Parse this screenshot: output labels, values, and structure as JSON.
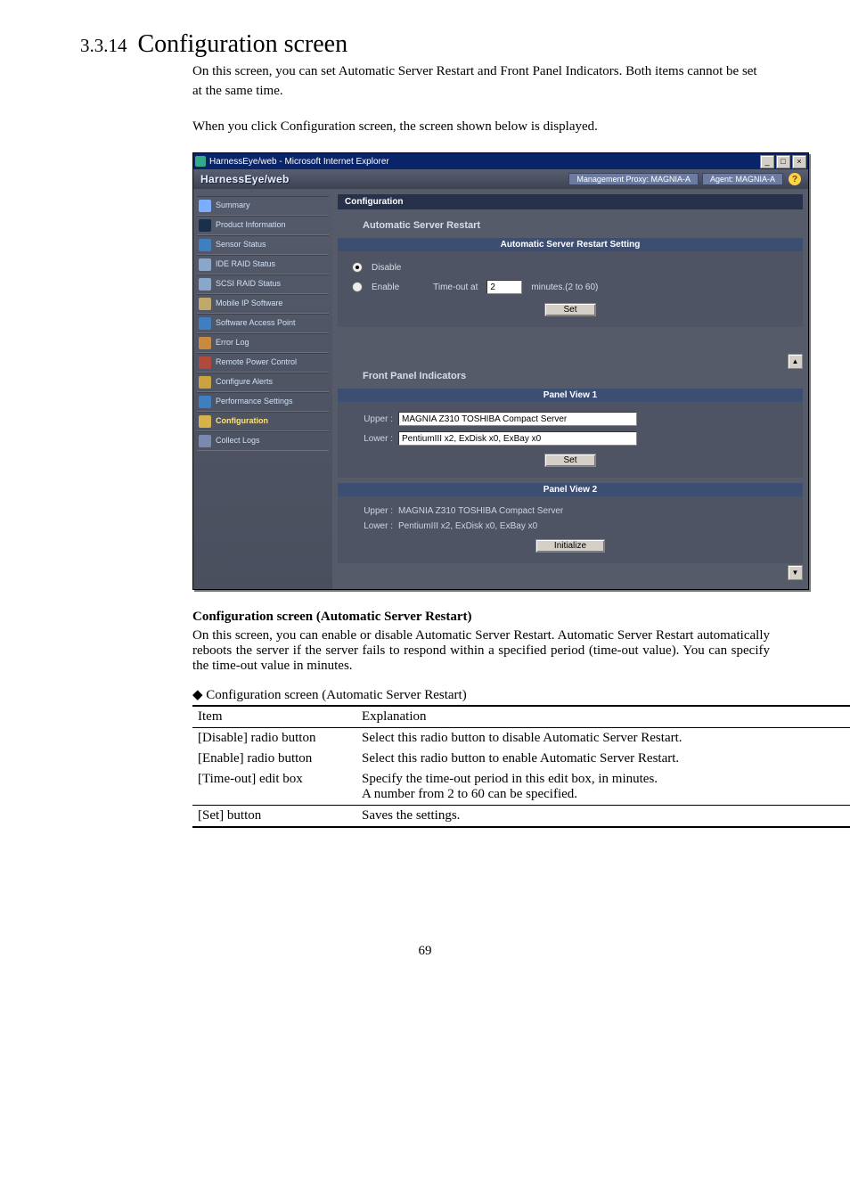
{
  "heading": {
    "num": "3.3.14",
    "title": "Configuration screen"
  },
  "intro": {
    "p1": "On this screen, you can set Automatic Server Restart and Front Panel Indicators. Both items cannot be set at the same time.",
    "p2": "When you click Configuration screen, the screen shown below is displayed."
  },
  "shot": {
    "window_title": "HarnessEye/web - Microsoft Internet Explorer",
    "brand": "HarnessEye/web",
    "mgmt_proxy": "Management Proxy: MAGNIA-A",
    "agent": "Agent: MAGNIA-A",
    "help": "?",
    "side": [
      {
        "label": "Summary",
        "ico": "#7caeff"
      },
      {
        "label": "Product Information",
        "ico": "#1a2f4a"
      },
      {
        "label": "Sensor Status",
        "ico": "#3f7fbf"
      },
      {
        "label": "IDE RAID Status",
        "ico": "#8aa6c8"
      },
      {
        "label": "SCSI RAID Status",
        "ico": "#8aa6c8"
      },
      {
        "label": "Mobile IP Software",
        "ico": "#bfa86a"
      },
      {
        "label": "Software Access Point",
        "ico": "#3f7fbf"
      },
      {
        "label": "Error Log",
        "ico": "#c98a3f"
      },
      {
        "label": "Remote Power Control",
        "ico": "#b04a3a"
      },
      {
        "label": "Configure Alerts",
        "ico": "#caa23f"
      },
      {
        "label": "Performance Settings",
        "ico": "#3f7fbf"
      },
      {
        "label": "Configuration",
        "ico": "#d6b24a",
        "active": true
      },
      {
        "label": "Collect Logs",
        "ico": "#7a8aae"
      }
    ],
    "section_title": "Configuration",
    "asr": {
      "heading": "Automatic Server Restart",
      "panel_title": "Automatic Server Restart Setting",
      "disable": "Disable",
      "enable": "Enable",
      "timeout_label": "Time-out at",
      "timeout_value": "2",
      "timeout_unit": "minutes.(2 to 60)",
      "set": "Set"
    },
    "fpi": {
      "heading": "Front Panel Indicators",
      "pv1": {
        "title": "Panel View 1",
        "upper_label": "Upper :",
        "upper_value": "MAGNIA Z310 TOSHIBA Compact Server",
        "lower_label": "Lower :",
        "lower_value": "PentiumIII x2, ExDisk x0, ExBay x0",
        "set": "Set"
      },
      "pv2": {
        "title": "Panel View 2",
        "upper_label": "Upper :",
        "upper_text": "MAGNIA Z310 TOSHIBA Compact Server",
        "lower_label": "Lower :",
        "lower_text": "PentiumIII x2, ExDisk x0, ExBay x0",
        "init": "Initialize"
      }
    }
  },
  "after": {
    "title": "Configuration screen (Automatic Server Restart)",
    "para": "On this screen, you can enable or disable Automatic Server Restart.  Automatic Server Restart automatically reboots the server if the server fails to respond within a specified period (time-out value). You can specify the time-out value in minutes."
  },
  "table": {
    "caption": "◆ Configuration screen (Automatic Server Restart)",
    "head": {
      "c1": "Item",
      "c2": "Explanation"
    },
    "rows": [
      {
        "c1": "[Disable] radio button",
        "c2": "Select this radio button to disable Automatic Server Restart."
      },
      {
        "c1": "[Enable] radio button",
        "c2": "Select this radio button to enable Automatic Server Restart."
      },
      {
        "c1": "[Time-out] edit box",
        "c2": "Specify the time-out period in this edit box, in minutes.\nA number from 2 to 60 can be specified."
      },
      {
        "c1": "[Set] button",
        "c2": "Saves the settings."
      }
    ]
  },
  "page_no": "69"
}
